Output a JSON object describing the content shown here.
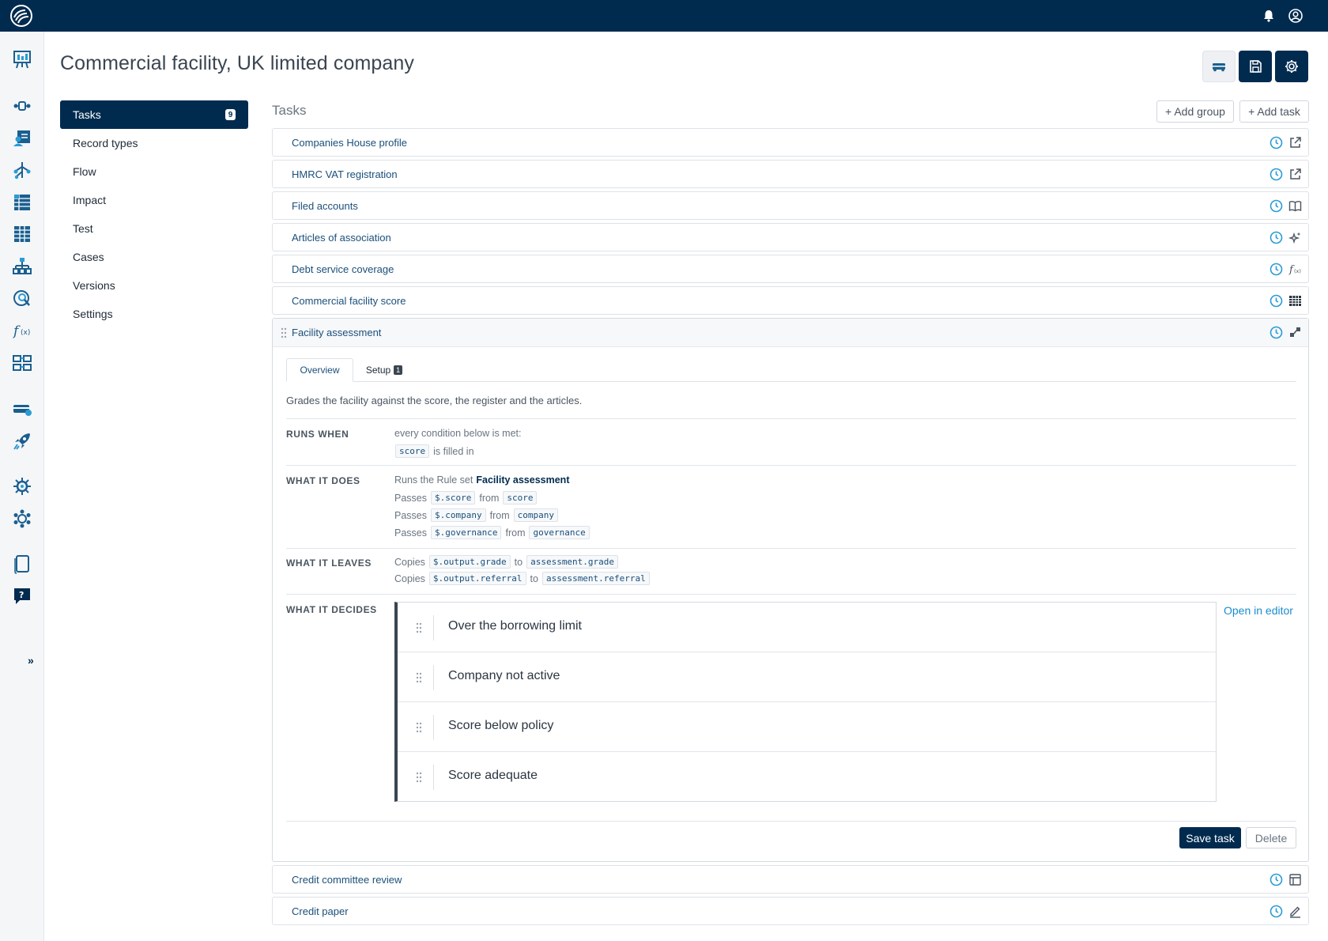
{
  "page": {
    "title": "Commercial facility, UK limited company"
  },
  "side_nav": [
    {
      "label": "Tasks",
      "badge": "9",
      "active": true
    },
    {
      "label": "Record types"
    },
    {
      "label": "Flow"
    },
    {
      "label": "Impact"
    },
    {
      "label": "Test"
    },
    {
      "label": "Cases"
    },
    {
      "label": "Versions"
    },
    {
      "label": "Settings"
    }
  ],
  "tasks_panel": {
    "title": "Tasks",
    "add_group": "+ Add group",
    "add_task": "+ Add task"
  },
  "tasks": [
    {
      "label": "Companies House profile",
      "icon": "external-link-icon"
    },
    {
      "label": "HMRC VAT registration",
      "icon": "external-link-icon"
    },
    {
      "label": "Filed accounts",
      "icon": "book-icon"
    },
    {
      "label": "Articles of association",
      "icon": "sparkle-icon"
    },
    {
      "label": "Debt service coverage",
      "icon": "function-icon"
    },
    {
      "label": "Commercial facility score",
      "icon": "table-grid-icon"
    },
    {
      "label": "Facility assessment",
      "icon": "rule-set-icon"
    },
    {
      "label": "Credit committee review",
      "icon": "layout-icon"
    },
    {
      "label": "Credit paper",
      "icon": "pencil-icon"
    }
  ],
  "expanded_task": {
    "tabs": {
      "overview": "Overview",
      "setup": "Setup",
      "setup_badge": "1"
    },
    "description": "Grades the facility against the score, the register and the articles.",
    "runs_when": {
      "label": "RUNS WHEN",
      "intro": "every condition below is met:",
      "condition_field": "score",
      "condition_text": "is filled in"
    },
    "what_it_does": {
      "label": "WHAT IT DOES",
      "prefix": "Runs the Rule set",
      "rule_set": "Facility assessment",
      "passes_word": "Passes",
      "from_word": "from",
      "inputs": [
        {
          "param": "$.score",
          "source": "score"
        },
        {
          "param": "$.company",
          "source": "company"
        },
        {
          "param": "$.governance",
          "source": "governance"
        }
      ]
    },
    "what_it_leaves": {
      "label": "WHAT IT LEAVES",
      "copies_word": "Copies",
      "to_word": "to",
      "outputs": [
        {
          "from": "$.output.grade",
          "to": "assessment.grade"
        },
        {
          "from": "$.output.referral",
          "to": "assessment.referral"
        }
      ]
    },
    "what_it_decides": {
      "label": "WHAT IT DECIDES",
      "open_editor": "Open in editor",
      "items": [
        "Over the borrowing limit",
        "Company not active",
        "Score below policy",
        "Score adequate"
      ]
    },
    "save_label": "Save task",
    "delete_label": "Delete"
  },
  "colors": {
    "navy": "#002b4f",
    "link": "#1a4f7a",
    "accent": "#1a8ccf",
    "clock": "#2a9bd6"
  }
}
